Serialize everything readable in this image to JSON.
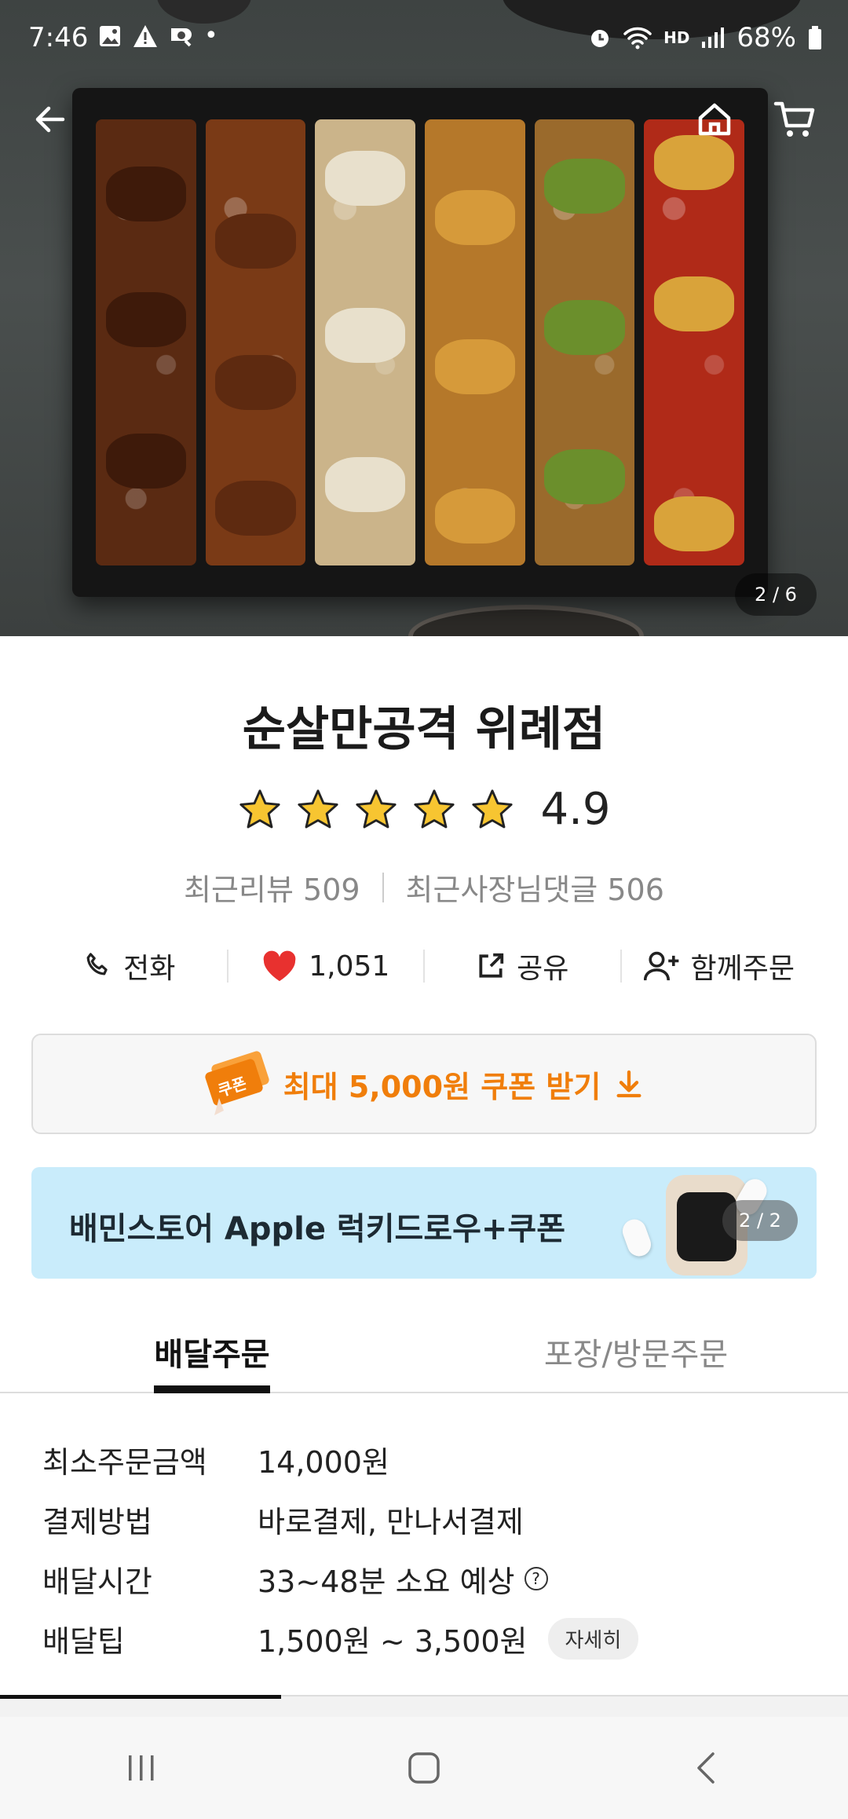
{
  "status_bar": {
    "time": "7:46",
    "battery": "68%",
    "network_label": "HD"
  },
  "hero": {
    "counter": "2 / 6"
  },
  "store": {
    "name": "순살만공격 위례점",
    "rating": "4.9",
    "recent_reviews": "최근리뷰 509",
    "owner_replies": "최근사장님댓글 506"
  },
  "actions": {
    "call": "전화",
    "likes": "1,051",
    "share": "공유",
    "group_order": "함께주문"
  },
  "coupon": {
    "label": "최대 5,000원 쿠폰 받기",
    "tag": "쿠폰"
  },
  "banner": {
    "text": "배민스토어 Apple 럭키드로우+쿠폰",
    "counter": "2 / 2"
  },
  "tabs": [
    {
      "label": "배달주문",
      "active": true
    },
    {
      "label": "포장/방문주문",
      "active": false
    }
  ],
  "info": {
    "min_order_label": "최소주문금액",
    "min_order_value": "14,000원",
    "payment_label": "결제방법",
    "payment_value": "바로결제, 만나서결제",
    "delivery_time_label": "배달시간",
    "delivery_time_value": "33~48분 소요 예상",
    "delivery_tip_label": "배달팁",
    "delivery_tip_value": "1,500원 ~ 3,500원",
    "detail_button": "자세히"
  },
  "colors": {
    "accent_orange": "#f07e0b",
    "heart_red": "#e8312f",
    "star_gold": "#f7c531",
    "banner_bg": "#c9ecfb"
  }
}
